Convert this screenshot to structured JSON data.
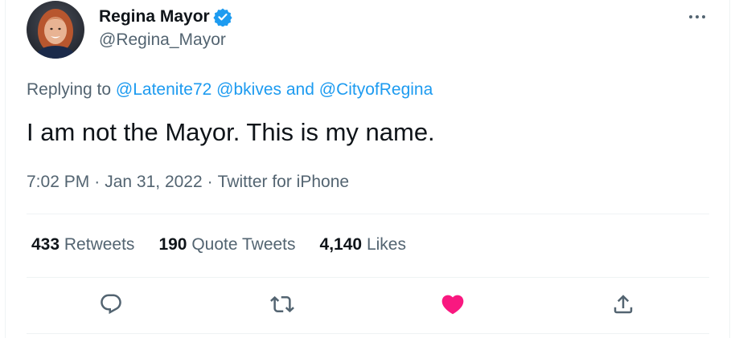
{
  "author": {
    "display_name": "Regina Mayor",
    "handle": "@Regina_Mayor",
    "verified": true
  },
  "reply_context": {
    "prefix": "Replying to",
    "mentions": [
      "@Latenite72",
      "@bkives",
      "@CityofRegina"
    ],
    "conjunction": "and"
  },
  "tweet_text": "I am not the Mayor. This is my name.",
  "meta": {
    "time": "7:02 PM",
    "separator": "·",
    "date": "Jan 31, 2022",
    "source": "Twitter for iPhone"
  },
  "stats": {
    "retweets_count": "433",
    "retweets_label": "Retweets",
    "quotes_count": "190",
    "quotes_label": "Quote Tweets",
    "likes_count": "4,140",
    "likes_label": "Likes"
  },
  "actions": [
    "reply-icon",
    "retweet-icon",
    "like-icon",
    "share-icon"
  ],
  "colors": {
    "link": "#1d9bf0",
    "secondary_text": "#536471",
    "like_active": "#f91880",
    "verified_badge": "#1d9bf0"
  }
}
